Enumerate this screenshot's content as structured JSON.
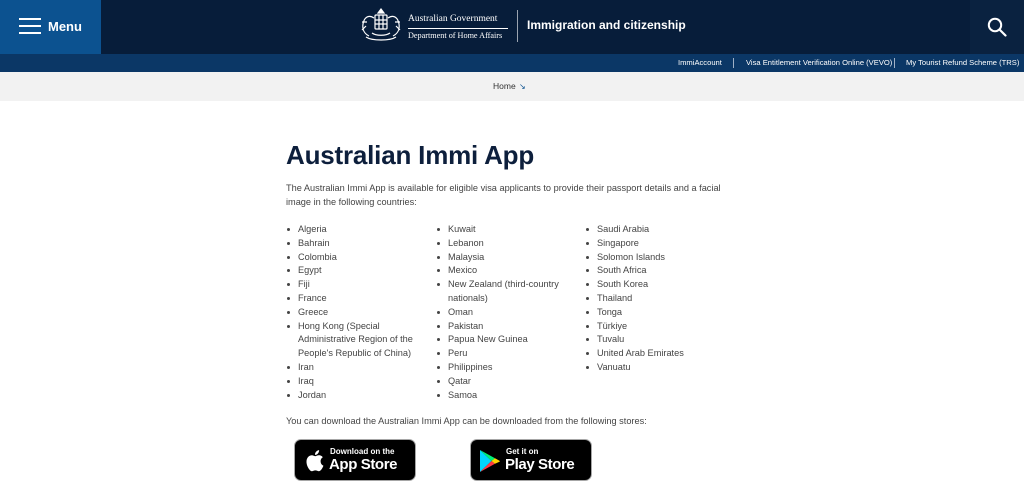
{
  "header": {
    "menu_label": "Menu",
    "gov_line1": "Australian Government",
    "gov_line2": "Department of Home Affairs",
    "site_title": "Immigration and citizenship"
  },
  "subnav": {
    "links": [
      "ImmiAccount",
      "Visa Entitlement Verification Online (VEVO)",
      "My Tourist Refund Scheme (TRS)"
    ]
  },
  "breadcrumb": {
    "home": "Home",
    "arrow": "↘"
  },
  "main": {
    "title": "Australian Immi App",
    "intro": "The Australian Immi App is available for eligible visa applicants to provide their passport details and a facial image in the following countries:",
    "countries_col1": [
      "Algeria",
      "Bahrain",
      "Colombia",
      "Egypt",
      "Fiji",
      "France",
      "Greece",
      "Hong Kong (Special Administrative Region of the People's Republic of China)",
      "Iran",
      "Iraq",
      "Jordan"
    ],
    "countries_col2": [
      "Kuwait",
      "Lebanon",
      "Malaysia",
      "Mexico",
      "New Zealand (third-country nationals)",
      "Oman",
      "Pakistan",
      "Papua New Guinea",
      "Peru",
      "Philippines",
      "Qatar",
      "Samoa"
    ],
    "countries_col3": [
      "Saudi Arabia",
      "Singapore",
      "Solomon Islands",
      "South Africa",
      "South Korea",
      "Thailand",
      "Tonga",
      "Türkiye",
      "Tuvalu",
      "United Arab Emirates",
      "Vanuatu"
    ],
    "download_text": "You can download the Australian Immi App can be downloaded from the following stores:"
  },
  "stores": {
    "apple_small": "Download on the",
    "apple_big": "App Store",
    "google_small": "Get it on",
    "google_big": "Play Store"
  },
  "colors": {
    "header_bg": "#071d3a",
    "menu_bg": "#0c5290",
    "subnav_bg": "#0b3766",
    "title_color": "#0d1f3c"
  }
}
